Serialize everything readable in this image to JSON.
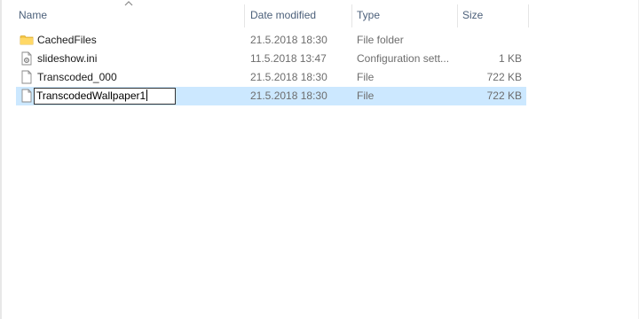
{
  "columns": {
    "name": "Name",
    "date_modified": "Date modified",
    "type": "Type",
    "size": "Size"
  },
  "sort": {
    "column": "name",
    "direction": "ascending",
    "icon": "sort-up-arrow-icon"
  },
  "files": [
    {
      "name": "CachedFiles",
      "date": "21.5.2018 18:30",
      "type": "File folder",
      "size": "",
      "icon": "folder-icon"
    },
    {
      "name": "slideshow.ini",
      "date": "11.5.2018 13:47",
      "type": "Configuration sett...",
      "size": "1 KB",
      "icon": "settings-file-icon"
    },
    {
      "name": "Transcoded_000",
      "date": "21.5.2018 18:30",
      "type": "File",
      "size": "722 KB",
      "icon": "file-icon"
    },
    {
      "name": "TranscodedWallpaper1",
      "date": "21.5.2018 18:30",
      "type": "File",
      "size": "722 KB",
      "icon": "file-icon",
      "selected": true,
      "renaming": true
    }
  ],
  "colors": {
    "selection": "#cce8ff",
    "header_text": "#4c607a",
    "folder": "#f5c84a"
  }
}
